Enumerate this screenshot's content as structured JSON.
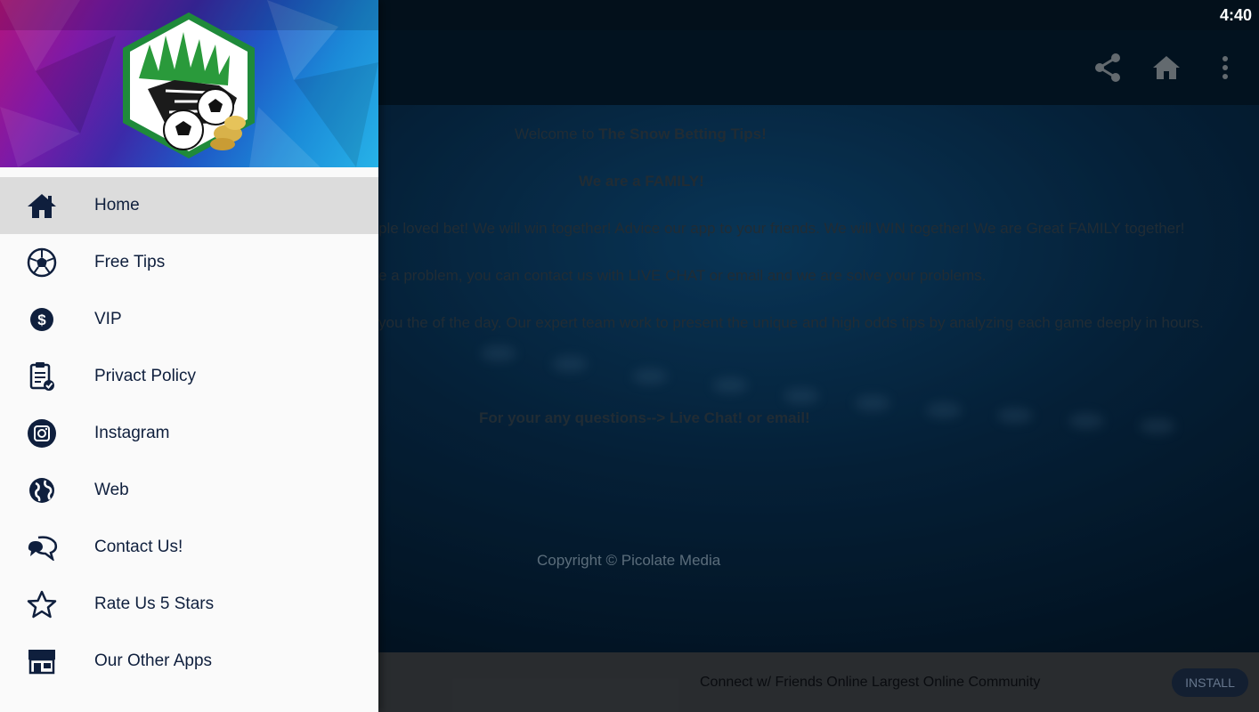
{
  "status_bar": {
    "time": "4:40"
  },
  "app_bar": {
    "icons": [
      "share-icon",
      "home-icon",
      "more-vert-icon"
    ]
  },
  "content": {
    "welcome_prefix": "Welcome to ",
    "welcome_app": "The Snow Betting Tips!",
    "family": "We are a FAMILY!",
    "line1": "ple loved bet! We will win together! Advice our app to your friends. We will WIN together! We are Great FAMILY together!",
    "line2": "e a problem, you can contact us with LIVE CHAT or email and we are solve your problems.",
    "line3": "you the of the day. Our expert team work to present the unique and high odds tips by analyzing each game deeply in hours.",
    "questions": "For your any questions--> Live Chat! or  email!",
    "copyright": "Copyright © Picolate Media"
  },
  "ad": {
    "text": "Connect w/ Friends Online Largest Online Community",
    "install_label": "INSTALL"
  },
  "drawer": {
    "items": [
      {
        "label": "Home",
        "icon": "home-icon"
      },
      {
        "label": "Free Tips",
        "icon": "soccer-ball-icon"
      },
      {
        "label": "VIP",
        "icon": "dollar-icon"
      },
      {
        "label": "Privact Policy",
        "icon": "clipboard-check-icon"
      },
      {
        "label": "Instagram",
        "icon": "instagram-icon"
      },
      {
        "label": "Web",
        "icon": "globe-icon"
      },
      {
        "label": "Contact Us!",
        "icon": "chat-bubbles-icon"
      },
      {
        "label": "Rate Us 5 Stars",
        "icon": "star-icon"
      },
      {
        "label": "Our Other Apps",
        "icon": "store-icon"
      }
    ]
  },
  "colors": {
    "drawer_text": "#0f1f3d",
    "active_item_bg": "#dcdcdc",
    "logo_border": "#1f8a3a"
  }
}
